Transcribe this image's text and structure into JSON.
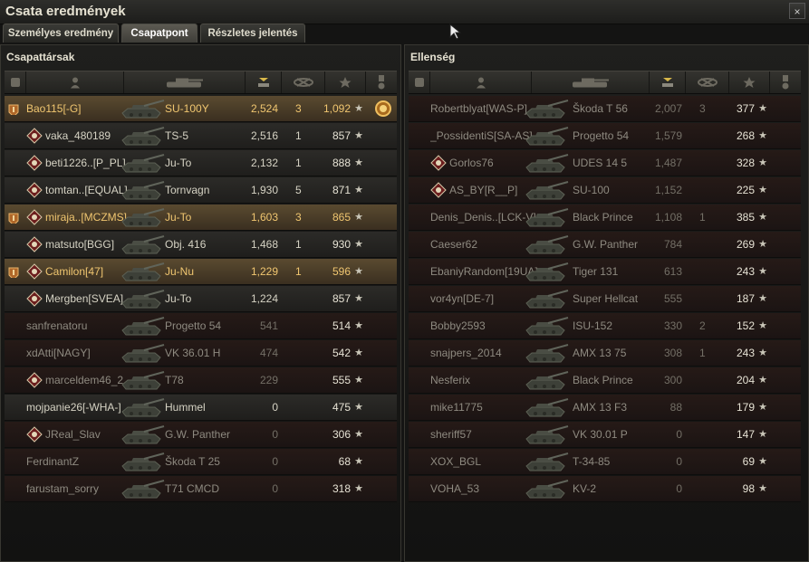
{
  "window": {
    "title": "Csata eredmények",
    "close_label": "×"
  },
  "tabs": [
    {
      "label": "Személyes eredmény",
      "active": false
    },
    {
      "label": "Csapatpont",
      "active": true
    },
    {
      "label": "Részletes jelentés",
      "active": false
    }
  ],
  "colors": {
    "own_player": "#f0c670",
    "alive_row": "#2c2b28",
    "dead_row": "#261a17"
  },
  "allies": {
    "title": "Csapattársak",
    "rows": [
      {
        "platoon": true,
        "clan": "",
        "name": "Bao115[-G]",
        "vehicle": "SU-100Y",
        "damage": "2,524",
        "kills": "3",
        "xp": "1,092",
        "medal": true,
        "state": "mine"
      },
      {
        "platoon": false,
        "clan": "emblem",
        "name": "vaka_480189",
        "vehicle": "TS-5",
        "damage": "2,516",
        "kills": "1",
        "xp": "857",
        "medal": false,
        "state": "alive"
      },
      {
        "platoon": false,
        "clan": "emblem",
        "name": "beti1226..[P_PL]",
        "vehicle": "Ju-To",
        "damage": "2,132",
        "kills": "1",
        "xp": "888",
        "medal": false,
        "state": "alive"
      },
      {
        "platoon": false,
        "clan": "emblem",
        "name": "tomtan..[EQUAL]",
        "vehicle": "Tornvagn",
        "damage": "1,930",
        "kills": "5",
        "xp": "871",
        "medal": false,
        "state": "alive"
      },
      {
        "platoon": true,
        "clan": "emblem",
        "name": "miraja..[MCZMS]",
        "vehicle": "Ju-To",
        "damage": "1,603",
        "kills": "3",
        "xp": "865",
        "medal": false,
        "state": "mine"
      },
      {
        "platoon": false,
        "clan": "emblem",
        "name": "matsuto[BGG]",
        "vehicle": "Obj. 416",
        "damage": "1,468",
        "kills": "1",
        "xp": "930",
        "medal": false,
        "state": "alive"
      },
      {
        "platoon": true,
        "clan": "emblem",
        "name": "Camilon[47]",
        "vehicle": "Ju-Nu",
        "damage": "1,229",
        "kills": "1",
        "xp": "596",
        "medal": false,
        "state": "mine"
      },
      {
        "platoon": false,
        "clan": "emblem",
        "name": "Mergben[SVEA]",
        "vehicle": "Ju-To",
        "damage": "1,224",
        "kills": "",
        "xp": "857",
        "medal": false,
        "state": "alive"
      },
      {
        "platoon": false,
        "clan": "",
        "name": "sanfrenatoru",
        "vehicle": "Progetto 54",
        "damage": "541",
        "kills": "",
        "xp": "514",
        "medal": false,
        "state": "dead"
      },
      {
        "platoon": false,
        "clan": "",
        "name": "xdAtti[NAGY]",
        "vehicle": "VK 36.01 H",
        "damage": "474",
        "kills": "",
        "xp": "542",
        "medal": false,
        "state": "dead"
      },
      {
        "platoon": false,
        "clan": "emblem",
        "name": "marceldem46_2..",
        "vehicle": "T78",
        "damage": "229",
        "kills": "",
        "xp": "555",
        "medal": false,
        "state": "dead"
      },
      {
        "platoon": false,
        "clan": "",
        "name": "mojpanie26[-WHA-]",
        "vehicle": "Hummel",
        "damage": "0",
        "kills": "",
        "xp": "475",
        "medal": false,
        "state": "alive"
      },
      {
        "platoon": false,
        "clan": "emblem",
        "name": "JReal_Slav",
        "vehicle": "G.W. Panther",
        "damage": "0",
        "kills": "",
        "xp": "306",
        "medal": false,
        "state": "dead"
      },
      {
        "platoon": false,
        "clan": "",
        "name": "FerdinantZ",
        "vehicle": "Škoda T 25",
        "damage": "0",
        "kills": "",
        "xp": "68",
        "medal": false,
        "state": "dead"
      },
      {
        "platoon": false,
        "clan": "",
        "name": "farustam_sorry",
        "vehicle": "T71 CMCD",
        "damage": "0",
        "kills": "",
        "xp": "318",
        "medal": false,
        "state": "dead"
      }
    ]
  },
  "enemies": {
    "title": "Ellenség",
    "rows": [
      {
        "clan": "",
        "name": "Robertblyat[WAS-P]",
        "vehicle": "Škoda T 56",
        "damage": "2,007",
        "kills": "3",
        "xp": "377"
      },
      {
        "clan": "",
        "name": "_PossidentiS[SA-AS]",
        "vehicle": "Progetto 54",
        "damage": "1,579",
        "kills": "",
        "xp": "268"
      },
      {
        "clan": "emblem",
        "name": "Gorlos76",
        "vehicle": "UDES 14 5",
        "damage": "1,487",
        "kills": "",
        "xp": "328"
      },
      {
        "clan": "emblem",
        "name": "AS_BY[R__P]",
        "vehicle": "SU-100",
        "damage": "1,152",
        "kills": "",
        "xp": "225"
      },
      {
        "clan": "",
        "name": "Denis_Denis..[LCK-V]",
        "vehicle": "Black Prince",
        "damage": "1,108",
        "kills": "1",
        "xp": "385"
      },
      {
        "clan": "",
        "name": "Caeser62",
        "vehicle": "G.W. Panther",
        "damage": "784",
        "kills": "",
        "xp": "269"
      },
      {
        "clan": "",
        "name": "EbaniyRandom[19UA]",
        "vehicle": "Tiger 131",
        "damage": "613",
        "kills": "",
        "xp": "243"
      },
      {
        "clan": "",
        "name": "vor4yn[DE-7]",
        "vehicle": "Super Hellcat",
        "damage": "555",
        "kills": "",
        "xp": "187"
      },
      {
        "clan": "",
        "name": "Bobby2593",
        "vehicle": "ISU-152",
        "damage": "330",
        "kills": "2",
        "xp": "152"
      },
      {
        "clan": "",
        "name": "snajpers_2014",
        "vehicle": "AMX 13 75",
        "damage": "308",
        "kills": "1",
        "xp": "243"
      },
      {
        "clan": "",
        "name": "Nesferix",
        "vehicle": "Black Prince",
        "damage": "300",
        "kills": "",
        "xp": "204"
      },
      {
        "clan": "",
        "name": "mike11775",
        "vehicle": "AMX 13 F3",
        "damage": "88",
        "kills": "",
        "xp": "179"
      },
      {
        "clan": "",
        "name": "sheriff57",
        "vehicle": "VK 30.01 P",
        "damage": "0",
        "kills": "",
        "xp": "147"
      },
      {
        "clan": "",
        "name": "XOX_BGL",
        "vehicle": "T-34-85",
        "damage": "0",
        "kills": "",
        "xp": "69"
      },
      {
        "clan": "",
        "name": "VOHA_53",
        "vehicle": "KV-2",
        "damage": "0",
        "kills": "",
        "xp": "98"
      }
    ]
  },
  "icons": {
    "column_squad": "squad-icon",
    "column_player": "player-icon",
    "column_tank": "tank-icon",
    "column_damage": "damage-icon",
    "column_kills": "kills-icon",
    "column_xp": "star-icon",
    "column_medal": "medal-icon",
    "star": "★"
  }
}
